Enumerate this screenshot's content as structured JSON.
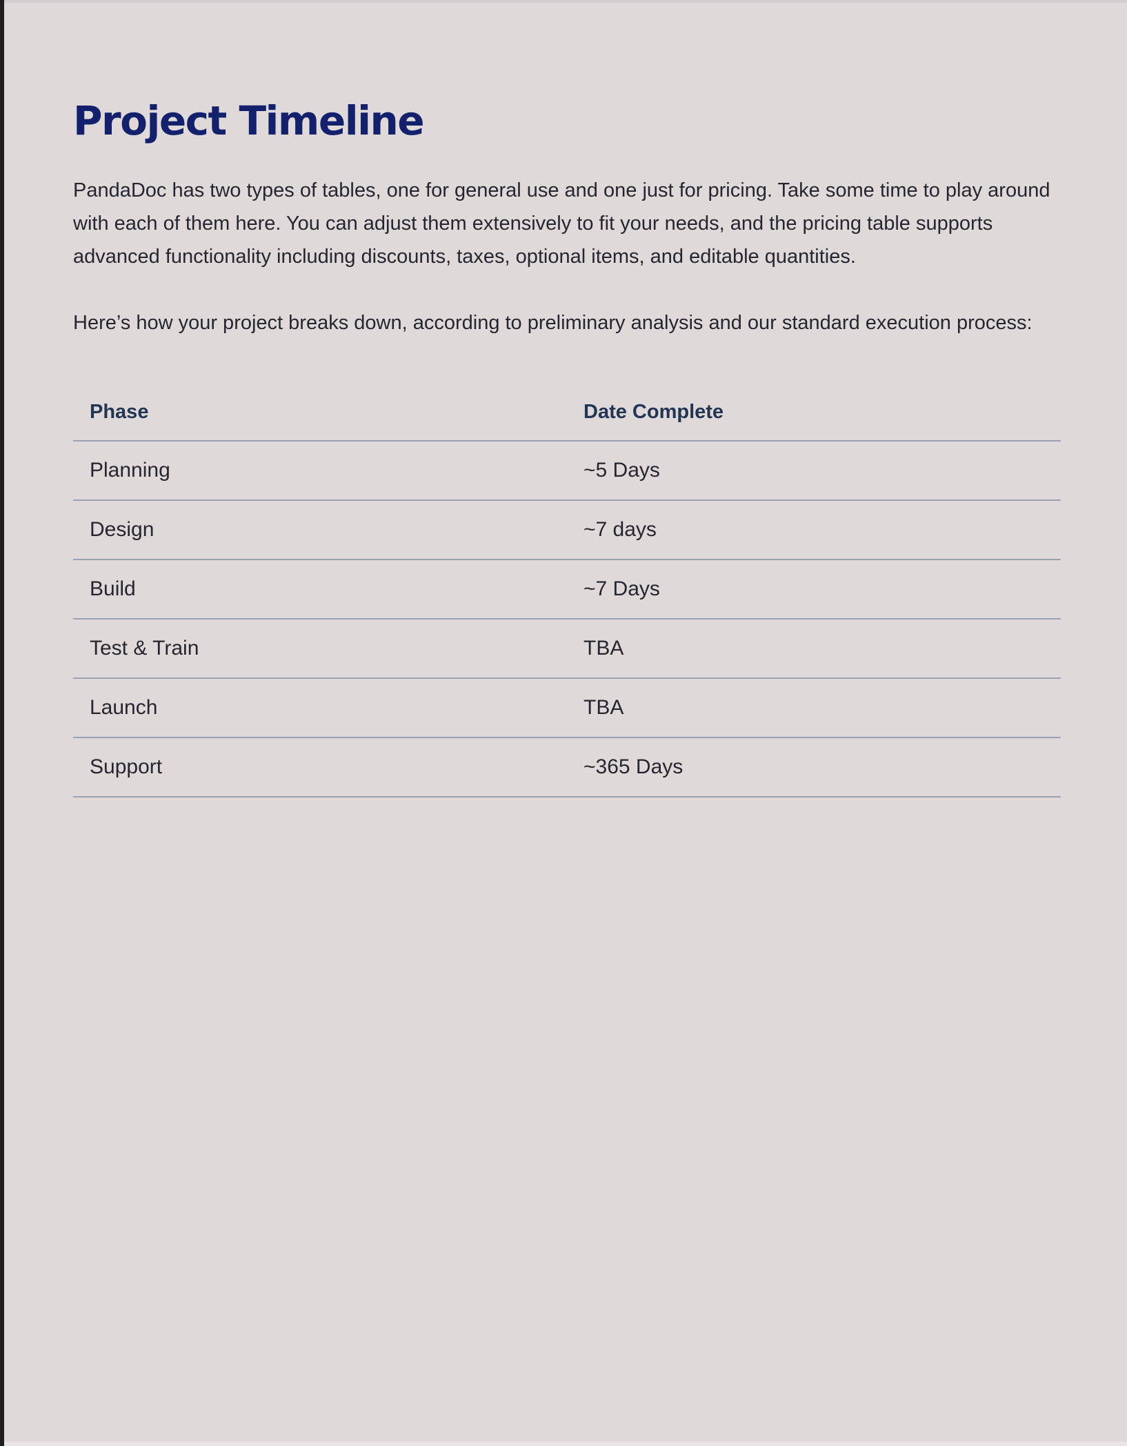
{
  "title": "Project Timeline",
  "intro": "PandaDoc has two types of tables, one for general use and one just for pricing. Take some time to play around with each of them here. You can adjust them extensively to fit your needs, and the pricing table supports advanced functionality including discounts, taxes, optional items, and editable quantities.",
  "process_text": "Here’s how your project breaks down, according to preliminary analysis and our standard execution process:",
  "table": {
    "headers": [
      "Phase",
      "Date Complete"
    ],
    "rows": [
      [
        "Planning",
        "~5 Days"
      ],
      [
        "Design",
        "~7 days"
      ],
      [
        "Build",
        "~7 Days"
      ],
      [
        "Test & Train",
        "TBA"
      ],
      [
        "Launch",
        "TBA"
      ],
      [
        "Support",
        "~365 Days"
      ]
    ]
  },
  "colors": {
    "background": "#dfd9da",
    "title": "#13206b",
    "header_text": "#223654",
    "body_text": "#26262f",
    "rule": "#9aa3b3"
  }
}
